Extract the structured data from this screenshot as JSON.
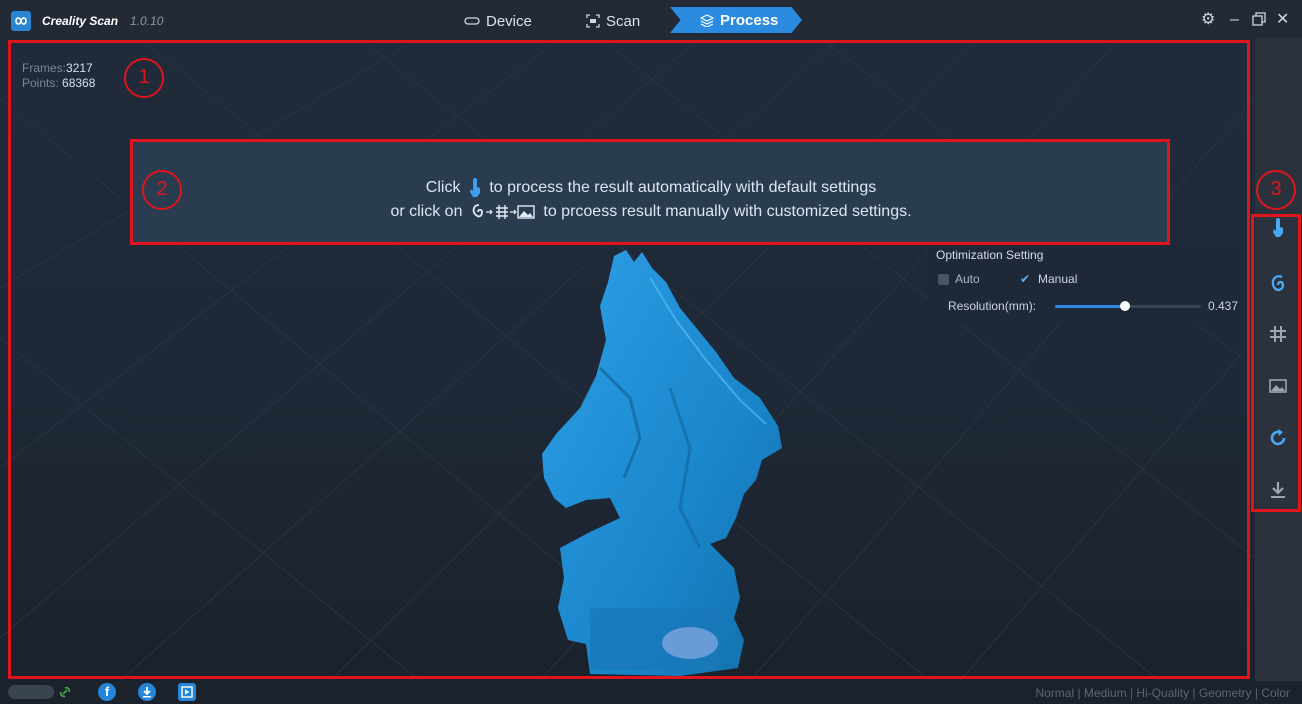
{
  "app": {
    "name": "Creality Scan",
    "version": "1.0.10"
  },
  "tabs": {
    "device": "Device",
    "scan": "Scan",
    "process": "Process"
  },
  "stats": {
    "frames_label": "Frames:",
    "frames_value": "3217",
    "points_label": "Points:",
    "points_value": "68368"
  },
  "banner": {
    "line1_pre": "Click",
    "line1_post": "to process the result automatically with default settings",
    "line2_pre": "or click on",
    "line2_post": "to prcoess result manually with customized settings."
  },
  "annotations": {
    "one": "1",
    "two": "2",
    "three": "3"
  },
  "optimization": {
    "title": "Optimization Setting",
    "auto_label": "Auto",
    "manual_label": "Manual",
    "resolution_label": "Resolution(mm):",
    "resolution_value": "0.437",
    "slider_fraction": 0.48
  },
  "toolbar": {
    "icons": [
      "hand-pointer-icon",
      "ear-shape-icon",
      "mesh-icon",
      "texture-image-icon",
      "rotate-icon",
      "download-icon"
    ]
  },
  "statusbar": {
    "icons": [
      "facebook-icon",
      "download-circle-icon",
      "video-icon"
    ],
    "quality_text": "Normal | Medium | Hi-Quality | Geometry | Color"
  },
  "colors": {
    "accent": "#2b8be0",
    "annotation": "#e0141c",
    "model": "#1e8ad0"
  }
}
